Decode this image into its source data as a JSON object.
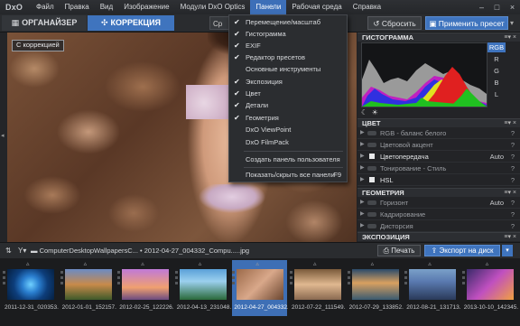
{
  "app": {
    "logo": "DxO"
  },
  "menubar": {
    "items": [
      "Файл",
      "Правка",
      "Вид",
      "Изображение",
      "Модули DxO Optics",
      "Панели",
      "Рабочая среда",
      "Справка"
    ],
    "active_index": 5
  },
  "window_controls": {
    "minimize": "–",
    "maximize": "□",
    "close": "×"
  },
  "modebar": {
    "tab_organizer": "ОРГАНАЙЗЕР",
    "tab_correction": "КОРРЕКЦИЯ",
    "tab_partial": "Ср",
    "reset_label": "Сбросить",
    "apply_preset_label": "Применить пресет"
  },
  "viewer": {
    "badge": "С коррекцией"
  },
  "panels_menu": {
    "items": [
      {
        "label": "Перемещение/масштаб",
        "checked": true
      },
      {
        "label": "Гистограмма",
        "checked": true
      },
      {
        "label": "EXIF",
        "checked": true
      },
      {
        "label": "Редактор пресетов",
        "checked": true
      },
      {
        "label": "Основные инструменты",
        "checked": false
      },
      {
        "label": "Экспозиция",
        "checked": true
      },
      {
        "label": "Цвет",
        "checked": true
      },
      {
        "label": "Детали",
        "checked": true
      },
      {
        "label": "Геометрия",
        "checked": true
      },
      {
        "label": "DxO ViewPoint",
        "checked": false
      },
      {
        "label": "DxO FilmPack",
        "checked": false
      }
    ],
    "create_panel": "Создать панель пользователя",
    "toggle_all": "Показать/скрыть все панели",
    "toggle_all_key": "F9"
  },
  "histogram": {
    "title": "ГИСТОГРАММА",
    "channels": [
      "RGB",
      "R",
      "G",
      "B",
      "L"
    ],
    "selected_channel": "RGB",
    "colors": {
      "red": "#e02020",
      "green": "#20c020",
      "blue": "#3030e0",
      "yellow": "#e0e020",
      "magenta": "#c020c0",
      "gray": "#9a9a9a"
    }
  },
  "color_panel": {
    "title": "ЦВЕТ",
    "rows": [
      {
        "name": "RGB - баланс белого",
        "value": "",
        "bright": false,
        "box": false
      },
      {
        "name": "Цветовой акцент",
        "value": "",
        "bright": false,
        "box": false
      },
      {
        "name": "Цветопередача",
        "value": "Auto",
        "bright": true,
        "box": true
      },
      {
        "name": "Тонирование - Стиль",
        "value": "",
        "bright": false,
        "box": false
      },
      {
        "name": "HSL",
        "value": "",
        "bright": true,
        "box": true
      }
    ]
  },
  "geometry_panel": {
    "title": "ГЕОМЕТРИЯ",
    "rows": [
      {
        "name": "Горизонт",
        "value": "Auto"
      },
      {
        "name": "Кадрирование",
        "value": ""
      },
      {
        "name": "Дисторсия",
        "value": ""
      }
    ]
  },
  "exposure_panel": {
    "title": "ЭКСПОЗИЦИЯ"
  },
  "filmstrip_toolbar": {
    "path": "ComputerDesktopWallpapersC... • 2012-04-27_004332_Compu.....jpg",
    "print_label": "Печать",
    "export_label": "Экспорт на диск"
  },
  "filmstrip": {
    "thumbnails": [
      {
        "caption": "2011-12-31_020353...",
        "selected": false
      },
      {
        "caption": "2012-01-01_152157...",
        "selected": false
      },
      {
        "caption": "2012-02-25_122226...",
        "selected": false
      },
      {
        "caption": "2012-04-13_231048...",
        "selected": false
      },
      {
        "caption": "2012-04-27_004332...",
        "selected": true
      },
      {
        "caption": "2012-07-22_111549...",
        "selected": false
      },
      {
        "caption": "2012-07-29_133852...",
        "selected": false
      },
      {
        "caption": "2012-08-21_131713...",
        "selected": false
      },
      {
        "caption": "2013-10-10_142345...",
        "selected": false
      }
    ]
  }
}
